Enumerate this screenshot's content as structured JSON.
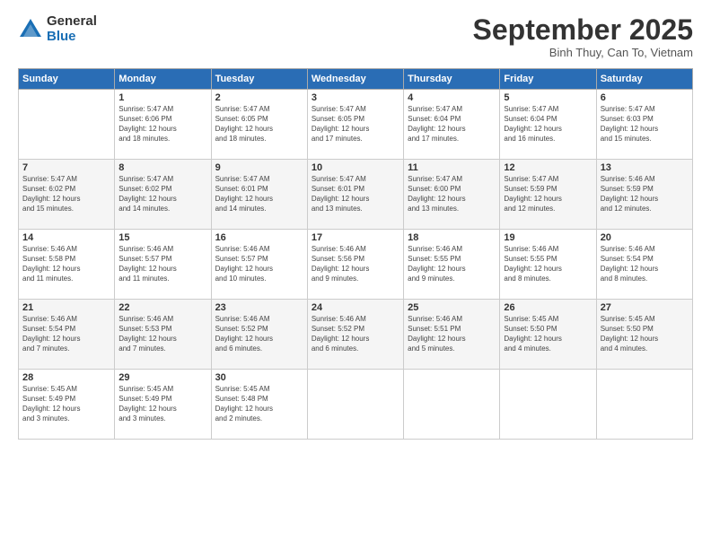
{
  "logo": {
    "general": "General",
    "blue": "Blue"
  },
  "header": {
    "month": "September 2025",
    "location": "Binh Thuy, Can To, Vietnam"
  },
  "days_of_week": [
    "Sunday",
    "Monday",
    "Tuesday",
    "Wednesday",
    "Thursday",
    "Friday",
    "Saturday"
  ],
  "weeks": [
    [
      {
        "num": "",
        "info": ""
      },
      {
        "num": "1",
        "info": "Sunrise: 5:47 AM\nSunset: 6:06 PM\nDaylight: 12 hours\nand 18 minutes."
      },
      {
        "num": "2",
        "info": "Sunrise: 5:47 AM\nSunset: 6:05 PM\nDaylight: 12 hours\nand 18 minutes."
      },
      {
        "num": "3",
        "info": "Sunrise: 5:47 AM\nSunset: 6:05 PM\nDaylight: 12 hours\nand 17 minutes."
      },
      {
        "num": "4",
        "info": "Sunrise: 5:47 AM\nSunset: 6:04 PM\nDaylight: 12 hours\nand 17 minutes."
      },
      {
        "num": "5",
        "info": "Sunrise: 5:47 AM\nSunset: 6:04 PM\nDaylight: 12 hours\nand 16 minutes."
      },
      {
        "num": "6",
        "info": "Sunrise: 5:47 AM\nSunset: 6:03 PM\nDaylight: 12 hours\nand 15 minutes."
      }
    ],
    [
      {
        "num": "7",
        "info": "Sunrise: 5:47 AM\nSunset: 6:02 PM\nDaylight: 12 hours\nand 15 minutes."
      },
      {
        "num": "8",
        "info": "Sunrise: 5:47 AM\nSunset: 6:02 PM\nDaylight: 12 hours\nand 14 minutes."
      },
      {
        "num": "9",
        "info": "Sunrise: 5:47 AM\nSunset: 6:01 PM\nDaylight: 12 hours\nand 14 minutes."
      },
      {
        "num": "10",
        "info": "Sunrise: 5:47 AM\nSunset: 6:01 PM\nDaylight: 12 hours\nand 13 minutes."
      },
      {
        "num": "11",
        "info": "Sunrise: 5:47 AM\nSunset: 6:00 PM\nDaylight: 12 hours\nand 13 minutes."
      },
      {
        "num": "12",
        "info": "Sunrise: 5:47 AM\nSunset: 5:59 PM\nDaylight: 12 hours\nand 12 minutes."
      },
      {
        "num": "13",
        "info": "Sunrise: 5:46 AM\nSunset: 5:59 PM\nDaylight: 12 hours\nand 12 minutes."
      }
    ],
    [
      {
        "num": "14",
        "info": "Sunrise: 5:46 AM\nSunset: 5:58 PM\nDaylight: 12 hours\nand 11 minutes."
      },
      {
        "num": "15",
        "info": "Sunrise: 5:46 AM\nSunset: 5:57 PM\nDaylight: 12 hours\nand 11 minutes."
      },
      {
        "num": "16",
        "info": "Sunrise: 5:46 AM\nSunset: 5:57 PM\nDaylight: 12 hours\nand 10 minutes."
      },
      {
        "num": "17",
        "info": "Sunrise: 5:46 AM\nSunset: 5:56 PM\nDaylight: 12 hours\nand 9 minutes."
      },
      {
        "num": "18",
        "info": "Sunrise: 5:46 AM\nSunset: 5:55 PM\nDaylight: 12 hours\nand 9 minutes."
      },
      {
        "num": "19",
        "info": "Sunrise: 5:46 AM\nSunset: 5:55 PM\nDaylight: 12 hours\nand 8 minutes."
      },
      {
        "num": "20",
        "info": "Sunrise: 5:46 AM\nSunset: 5:54 PM\nDaylight: 12 hours\nand 8 minutes."
      }
    ],
    [
      {
        "num": "21",
        "info": "Sunrise: 5:46 AM\nSunset: 5:54 PM\nDaylight: 12 hours\nand 7 minutes."
      },
      {
        "num": "22",
        "info": "Sunrise: 5:46 AM\nSunset: 5:53 PM\nDaylight: 12 hours\nand 7 minutes."
      },
      {
        "num": "23",
        "info": "Sunrise: 5:46 AM\nSunset: 5:52 PM\nDaylight: 12 hours\nand 6 minutes."
      },
      {
        "num": "24",
        "info": "Sunrise: 5:46 AM\nSunset: 5:52 PM\nDaylight: 12 hours\nand 6 minutes."
      },
      {
        "num": "25",
        "info": "Sunrise: 5:46 AM\nSunset: 5:51 PM\nDaylight: 12 hours\nand 5 minutes."
      },
      {
        "num": "26",
        "info": "Sunrise: 5:45 AM\nSunset: 5:50 PM\nDaylight: 12 hours\nand 4 minutes."
      },
      {
        "num": "27",
        "info": "Sunrise: 5:45 AM\nSunset: 5:50 PM\nDaylight: 12 hours\nand 4 minutes."
      }
    ],
    [
      {
        "num": "28",
        "info": "Sunrise: 5:45 AM\nSunset: 5:49 PM\nDaylight: 12 hours\nand 3 minutes."
      },
      {
        "num": "29",
        "info": "Sunrise: 5:45 AM\nSunset: 5:49 PM\nDaylight: 12 hours\nand 3 minutes."
      },
      {
        "num": "30",
        "info": "Sunrise: 5:45 AM\nSunset: 5:48 PM\nDaylight: 12 hours\nand 2 minutes."
      },
      {
        "num": "",
        "info": ""
      },
      {
        "num": "",
        "info": ""
      },
      {
        "num": "",
        "info": ""
      },
      {
        "num": "",
        "info": ""
      }
    ]
  ]
}
